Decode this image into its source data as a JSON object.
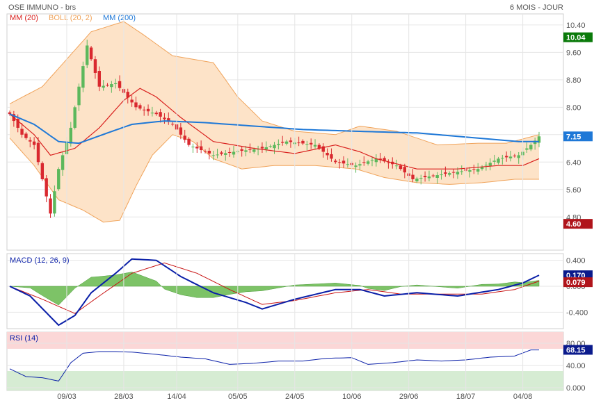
{
  "header": {
    "title": "OSE IMMUNO - brs",
    "period": "6 MOIS - JOUR"
  },
  "colors": {
    "up": "#5cb85c",
    "down": "#d9292f",
    "mm20": "#d9201e",
    "boll_fill": "#fde3c8",
    "boll_line": "#f0a35a",
    "mm200": "#1e78d7",
    "macd": "#0a1fa8",
    "signal": "#c81414",
    "hist": "#66b84c",
    "rsi": "#0a1fa8",
    "rsi_over": "#fbd7d7",
    "rsi_under": "#d6ecd3",
    "flag_green": "#0a7a0a",
    "flag_red": "#b0141b",
    "flag_blue": "#1e78d7",
    "flag_navy": "#0a1a8c"
  },
  "chart_data": [
    {
      "type": "candlestick",
      "legend": [
        {
          "name": "MM (20)",
          "color": "#d9201e"
        },
        {
          "name": "BOLL (20, 2)",
          "color": "#f0a35a"
        },
        {
          "name": "MM (200)",
          "color": "#1e78d7"
        }
      ],
      "x_ticks": [
        "09/03",
        "28/03",
        "14/04",
        "05/05",
        "24/05",
        "10/06",
        "29/06",
        "18/07",
        "04/08"
      ],
      "y_ticks": [
        "10.40",
        "9.60",
        "8.80",
        "8.00",
        "7.20",
        "6.40",
        "5.60",
        "4.80"
      ],
      "ylim": [
        4.4,
        10.6
      ],
      "value_flags": [
        {
          "label": "10.04",
          "value": 10.04,
          "color": "green"
        },
        {
          "label": "7.15",
          "value": 7.15,
          "color": "blue"
        },
        {
          "label": "4.60",
          "value": 4.6,
          "color": "red"
        }
      ],
      "series": [
        {
          "name": "Cours (OHLC, journalier)",
          "keyframes": [
            [
              0,
              7.8
            ],
            [
              3,
              7.2
            ],
            [
              6,
              6.9
            ],
            [
              10,
              4.9
            ],
            [
              12,
              6.2
            ],
            [
              15,
              7.4
            ],
            [
              19,
              9.8
            ],
            [
              22,
              8.6
            ],
            [
              26,
              8.7
            ],
            [
              31,
              8.0
            ],
            [
              36,
              7.8
            ],
            [
              40,
              7.5
            ],
            [
              44,
              6.9
            ],
            [
              50,
              6.6
            ],
            [
              55,
              6.7
            ],
            [
              62,
              6.8
            ],
            [
              68,
              7.0
            ],
            [
              75,
              6.9
            ],
            [
              80,
              6.4
            ],
            [
              85,
              6.3
            ],
            [
              90,
              6.5
            ],
            [
              95,
              6.3
            ],
            [
              99,
              5.9
            ],
            [
              104,
              6.0
            ],
            [
              109,
              6.1
            ],
            [
              115,
              6.2
            ],
            [
              120,
              6.5
            ],
            [
              125,
              6.6
            ],
            [
              128,
              6.9
            ],
            [
              130,
              7.15
            ]
          ]
        },
        {
          "name": "MM (20)",
          "keyframes": [
            [
              0,
              7.8
            ],
            [
              6,
              7.2
            ],
            [
              10,
              6.6
            ],
            [
              16,
              6.8
            ],
            [
              22,
              7.4
            ],
            [
              28,
              8.2
            ],
            [
              32,
              8.55
            ],
            [
              36,
              8.3
            ],
            [
              42,
              7.7
            ],
            [
              50,
              7.0
            ],
            [
              60,
              6.8
            ],
            [
              70,
              6.65
            ],
            [
              80,
              6.9
            ],
            [
              86,
              6.7
            ],
            [
              90,
              6.5
            ],
            [
              100,
              6.2
            ],
            [
              110,
              6.2
            ],
            [
              120,
              6.3
            ],
            [
              126,
              6.3
            ],
            [
              130,
              6.5
            ]
          ]
        },
        {
          "name": "BOLL (20, 2) haut",
          "keyframes": [
            [
              0,
              8.1
            ],
            [
              8,
              8.6
            ],
            [
              14,
              9.4
            ],
            [
              20,
              10.2
            ],
            [
              28,
              10.5
            ],
            [
              33,
              10.1
            ],
            [
              40,
              9.5
            ],
            [
              50,
              9.3
            ],
            [
              56,
              8.3
            ],
            [
              62,
              7.6
            ],
            [
              70,
              7.3
            ],
            [
              80,
              7.2
            ],
            [
              86,
              7.45
            ],
            [
              95,
              7.3
            ],
            [
              105,
              6.9
            ],
            [
              115,
              6.95
            ],
            [
              122,
              6.95
            ],
            [
              130,
              7.2
            ]
          ]
        },
        {
          "name": "BOLL (20, 2) bas",
          "keyframes": [
            [
              0,
              7.1
            ],
            [
              6,
              6.3
            ],
            [
              12,
              5.3
            ],
            [
              18,
              5.0
            ],
            [
              23,
              4.65
            ],
            [
              27,
              4.7
            ],
            [
              31,
              5.7
            ],
            [
              35,
              6.6
            ],
            [
              40,
              7.2
            ],
            [
              45,
              7.0
            ],
            [
              50,
              6.5
            ],
            [
              57,
              6.2
            ],
            [
              65,
              6.3
            ],
            [
              75,
              6.3
            ],
            [
              85,
              6.2
            ],
            [
              92,
              5.95
            ],
            [
              100,
              5.8
            ],
            [
              108,
              5.75
            ],
            [
              116,
              5.8
            ],
            [
              124,
              5.9
            ],
            [
              130,
              5.9
            ]
          ]
        },
        {
          "name": "MM (200)",
          "keyframes": [
            [
              0,
              7.8
            ],
            [
              6,
              7.5
            ],
            [
              12,
              7.0
            ],
            [
              17,
              6.95
            ],
            [
              24,
              7.25
            ],
            [
              30,
              7.5
            ],
            [
              38,
              7.6
            ],
            [
              48,
              7.55
            ],
            [
              60,
              7.45
            ],
            [
              72,
              7.35
            ],
            [
              85,
              7.3
            ],
            [
              100,
              7.25
            ],
            [
              115,
              7.1
            ],
            [
              125,
              7.0
            ],
            [
              130,
              7.0
            ]
          ]
        }
      ]
    },
    {
      "type": "line",
      "legend": "MACD (12, 26, 9)",
      "y_ticks": [
        "0.400",
        "0.000",
        "-0.400"
      ],
      "ylim": [
        -0.6,
        0.45
      ],
      "value_flags": [
        {
          "label": "0.170",
          "value": 0.17,
          "color": "navy"
        },
        {
          "label": "0.079",
          "value": 0.079,
          "color": "red"
        }
      ],
      "series": [
        {
          "name": "MACD",
          "keyframes": [
            [
              0,
              0.0
            ],
            [
              5,
              -0.15
            ],
            [
              12,
              -0.6
            ],
            [
              16,
              -0.45
            ],
            [
              20,
              -0.1
            ],
            [
              26,
              0.2
            ],
            [
              30,
              0.42
            ],
            [
              36,
              0.4
            ],
            [
              42,
              0.15
            ],
            [
              50,
              -0.1
            ],
            [
              58,
              -0.25
            ],
            [
              62,
              -0.35
            ],
            [
              70,
              -0.2
            ],
            [
              80,
              -0.05
            ],
            [
              86,
              -0.05
            ],
            [
              92,
              -0.15
            ],
            [
              100,
              -0.1
            ],
            [
              110,
              -0.15
            ],
            [
              120,
              -0.05
            ],
            [
              126,
              0.05
            ],
            [
              130,
              0.17
            ]
          ]
        },
        {
          "name": "Signal",
          "keyframes": [
            [
              0,
              0.0
            ],
            [
              8,
              -0.2
            ],
            [
              16,
              -0.42
            ],
            [
              22,
              -0.15
            ],
            [
              30,
              0.2
            ],
            [
              38,
              0.36
            ],
            [
              46,
              0.2
            ],
            [
              54,
              -0.05
            ],
            [
              62,
              -0.28
            ],
            [
              70,
              -0.22
            ],
            [
              80,
              -0.1
            ],
            [
              88,
              -0.05
            ],
            [
              96,
              -0.12
            ],
            [
              106,
              -0.12
            ],
            [
              116,
              -0.12
            ],
            [
              124,
              -0.05
            ],
            [
              130,
              0.079
            ]
          ]
        }
      ]
    },
    {
      "type": "line",
      "legend": "RSI (14)",
      "y_ticks": [
        "80.00",
        "40.00",
        "0.000"
      ],
      "ylim": [
        0,
        100
      ],
      "value_flags": [
        {
          "label": "68.15",
          "value": 68.15,
          "color": "navy"
        }
      ],
      "series": [
        {
          "name": "RSI (14)",
          "keyframes": [
            [
              0,
              34
            ],
            [
              4,
              20
            ],
            [
              8,
              18
            ],
            [
              12,
              12
            ],
            [
              15,
              45
            ],
            [
              18,
              62
            ],
            [
              22,
              65
            ],
            [
              26,
              65
            ],
            [
              30,
              64
            ],
            [
              36,
              60
            ],
            [
              42,
              55
            ],
            [
              48,
              52
            ],
            [
              54,
              42
            ],
            [
              60,
              44
            ],
            [
              66,
              48
            ],
            [
              72,
              48
            ],
            [
              78,
              53
            ],
            [
              84,
              54
            ],
            [
              88,
              42
            ],
            [
              94,
              45
            ],
            [
              100,
              50
            ],
            [
              106,
              48
            ],
            [
              112,
              50
            ],
            [
              118,
              55
            ],
            [
              124,
              57
            ],
            [
              128,
              68
            ],
            [
              130,
              68
            ]
          ]
        }
      ]
    }
  ]
}
